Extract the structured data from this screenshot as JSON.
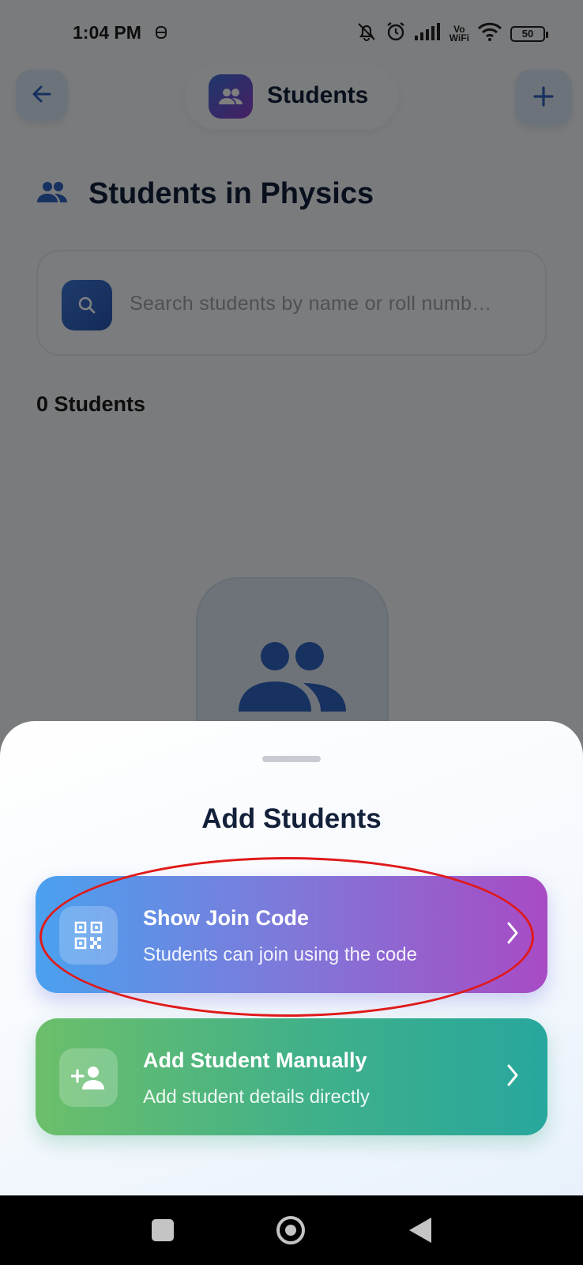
{
  "status_bar": {
    "time": "1:04 PM",
    "vowifi_top": "Vo",
    "vowifi_bottom": "WiFi",
    "battery": "50"
  },
  "header": {
    "title": "Students",
    "back_icon": "arrow-left-icon",
    "title_icon": "people-icon",
    "add_icon": "plus-icon"
  },
  "main": {
    "section_title": "Students in Physics",
    "search": {
      "placeholder": "Search students by name or roll numb…",
      "value": ""
    },
    "students_count": "0 Students"
  },
  "sheet": {
    "title": "Add Students",
    "options": [
      {
        "title": "Show Join Code",
        "subtitle": "Students can join using the code",
        "icon": "qr-code-icon"
      },
      {
        "title": "Add Student Manually",
        "subtitle": "Add student details directly",
        "icon": "person-add-icon"
      }
    ]
  },
  "colors": {
    "primary": "#2f62c0",
    "join_gradient": [
      "#4aa1ef",
      "#a84bc4"
    ],
    "manual_gradient": [
      "#6cbf6a",
      "#27a79d"
    ],
    "annotation": "#e01919"
  }
}
